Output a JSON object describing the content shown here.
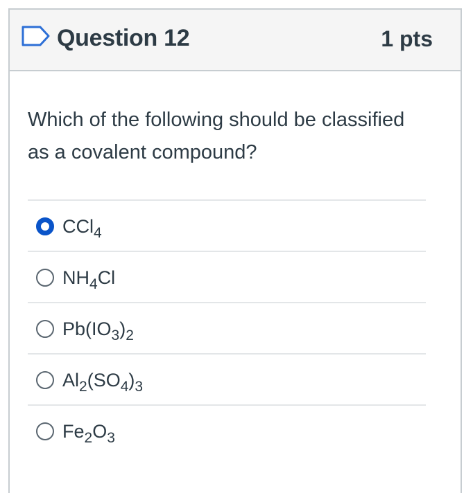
{
  "question": {
    "title": "Question 12",
    "points": "1 pts",
    "text": "Which of the following should be classified as a covalent compound?"
  },
  "answers": [
    {
      "id": "a1",
      "parts": [
        "CCl",
        "4"
      ],
      "selected": true
    },
    {
      "id": "a2",
      "parts": [
        "NH",
        "4",
        "Cl"
      ],
      "selected": false
    },
    {
      "id": "a3",
      "parts": [
        "Pb(IO",
        "3",
        ")",
        "2"
      ],
      "selected": false
    },
    {
      "id": "a4",
      "parts": [
        "Al",
        "2",
        "(SO",
        "4",
        ")",
        "3"
      ],
      "selected": false
    },
    {
      "id": "a5",
      "parts": [
        "Fe",
        "2",
        "O",
        "3"
      ],
      "selected": false
    }
  ],
  "colors": {
    "accent": "#0a54c9",
    "text": "#2d3b45",
    "border": "#c7cdd1"
  }
}
